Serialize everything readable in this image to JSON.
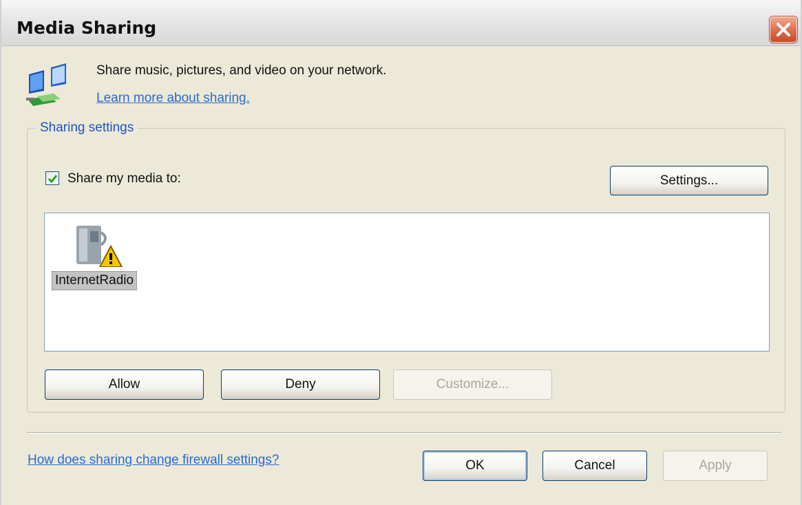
{
  "window": {
    "title": "Media Sharing"
  },
  "intro": {
    "text": "Share music, pictures, and video on your network.",
    "learn_link": "Learn more about sharing."
  },
  "sharing": {
    "legend": "Sharing settings",
    "share_checkbox_label": "Share my media to:",
    "share_checked": true,
    "settings_label": "Settings...",
    "devices": [
      {
        "name": "InternetRadio",
        "icon": "internet-radio-warning-icon"
      }
    ],
    "allow_label": "Allow",
    "deny_label": "Deny",
    "customize_label": "Customize..."
  },
  "footer": {
    "firewall_link": "How does sharing change firewall settings?",
    "ok_label": "OK",
    "cancel_label": "Cancel",
    "apply_label": "Apply"
  },
  "colors": {
    "link": "#2a6ad0",
    "legend": "#1f52c2",
    "dialog_bg": "#ece9d8"
  }
}
